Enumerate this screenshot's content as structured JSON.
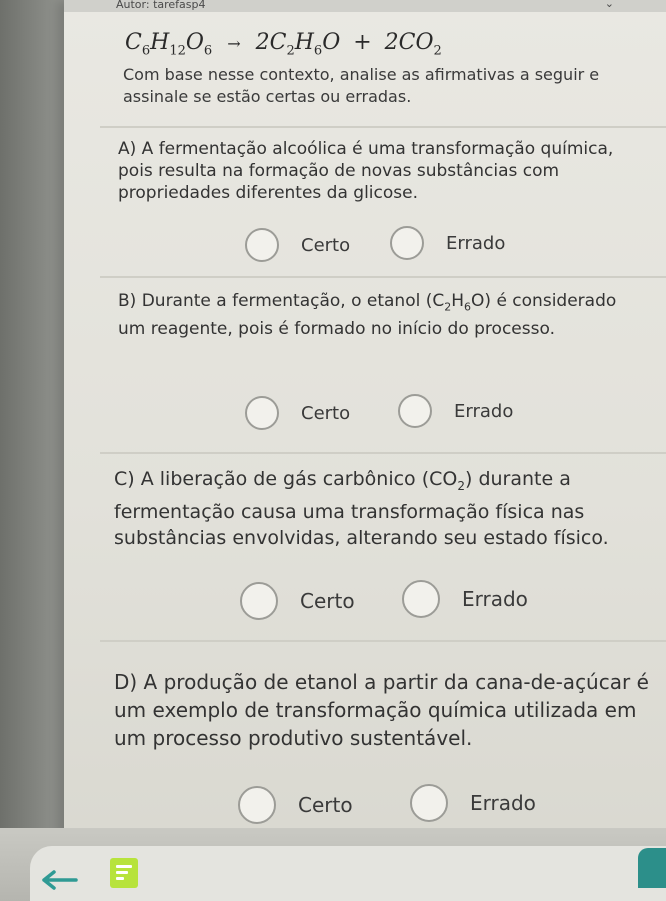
{
  "header": {
    "author": "Autor: tarefasp4",
    "chevron": "⌄"
  },
  "equation": {
    "reactant": "C",
    "r_sub1": "6",
    "r_mid": "H",
    "r_sub2": "12",
    "r_mid2": "O",
    "r_sub3": "6",
    "arrow": "→",
    "p1_coef": "2C",
    "p1_sub1": "2",
    "p1_mid": "H",
    "p1_sub2": "6",
    "p1_end": "O",
    "plus": "+",
    "p2": "2CO",
    "p2_sub": "2"
  },
  "intro": "Com base nesse contexto, analise as afirmativas a seguir e assinale se estão certas ou erradas.",
  "questions": [
    {
      "text": "A) A fermentação alcoólica é uma transformação química, pois resulta na formação de novas substâncias com propriedades diferentes da glicose.",
      "option_true": "Certo",
      "option_false": "Errado"
    },
    {
      "text_a": "B) Durante a fermentação, o etanol (C",
      "sub1": "2",
      "mid": "H",
      "sub2": "6",
      "text_b": "O) é considerado um reagente, pois é formado no início do processo.",
      "option_true": "Certo",
      "option_false": "Errado"
    },
    {
      "text_a": "C) A liberação de gás carbônico (CO",
      "sub1": "2",
      "text_b": ") durante a fermentação causa uma transformação física nas substâncias envolvidas, alterando seu estado físico.",
      "option_true": "Certo",
      "option_false": "Errado"
    },
    {
      "text": "D) A produção de etanol a partir da cana-de-açúcar é um exemplo de transformação química utilizada em um processo produtivo sustentável.",
      "option_true": "Certo",
      "option_false": "Errado"
    }
  ],
  "icons": {
    "back": "back-arrow-icon",
    "doc": "document-icon",
    "next": "next-tab"
  }
}
